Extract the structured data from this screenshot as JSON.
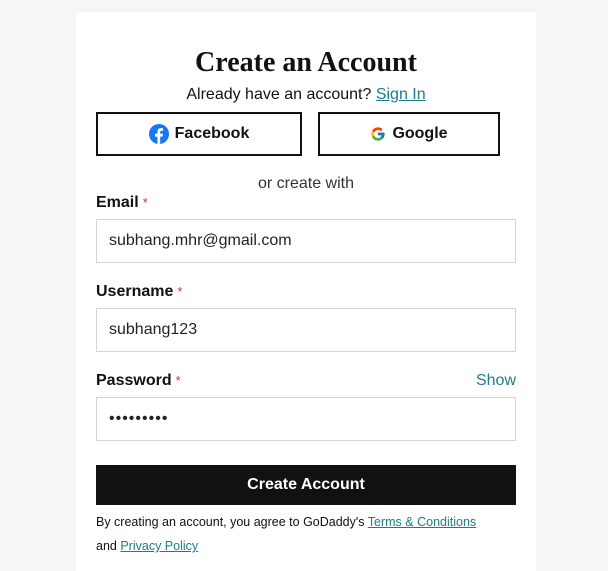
{
  "page": {
    "title": "Create an Account",
    "signin_prompt": "Already have an account?",
    "signin_link": "Sign In"
  },
  "social": {
    "facebook_label": "Facebook",
    "google_label": "Google",
    "divider_text": "or create with"
  },
  "form": {
    "email": {
      "label": "Email",
      "required_mark": "*",
      "value": "subhang.mhr@gmail.com"
    },
    "username": {
      "label": "Username",
      "required_mark": "*",
      "value": "subhang123"
    },
    "password": {
      "label": "Password",
      "required_mark": "*",
      "value": "•••••••••",
      "show_label": "Show"
    },
    "submit_label": "Create Account"
  },
  "terms": {
    "prefix": "By creating an account, you agree to GoDaddy's",
    "terms_link": "Terms & Conditions",
    "conjunction": "and",
    "privacy_link": "Privacy Policy"
  },
  "colors": {
    "link": "#1b7c8a",
    "button": "#111111",
    "required": "#c0392b",
    "facebook_blue": "#1877f2"
  },
  "icons": {
    "facebook": "facebook-icon",
    "google": "google-icon"
  }
}
